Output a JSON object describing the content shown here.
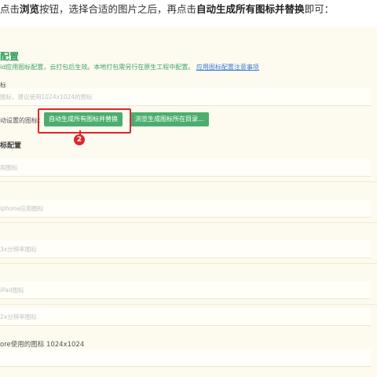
{
  "instruction": {
    "part1": "点击",
    "bold1": "浏览",
    "part2": "按钮，选择合适的图片之后，再点击",
    "bold2": "自动生成所有图标并替换",
    "part3": "即可："
  },
  "section": {
    "title": "配置",
    "description": "id应用图标配置，云打包后生效。本地打包需另行在原生工程中配置。",
    "link": "应用图标配置注意事项"
  },
  "fields": {
    "icon_label": "标",
    "icon_placeholder": "图标，建议使用1024x1024的图标",
    "auto_label": "动设置的图标：",
    "auto_button": "自动生成所有图标并替换",
    "browse_button": "浏览生成图标所在目录...",
    "subsection_title": "标配置",
    "placeholder_1": "用图标",
    "placeholder_2": "iphone应用图标",
    "placeholder_3": "3x分辨率图标",
    "placeholder_4": "iPad图标",
    "placeholder_5": "2x分辨率图标",
    "store_label": "ore使用的图标 1024x1024"
  },
  "annotation": {
    "step_number": "2"
  },
  "colors": {
    "accent_green": "#4cae6e",
    "highlight_red": "#e0262b",
    "panel_bg": "#fdfaf0"
  }
}
